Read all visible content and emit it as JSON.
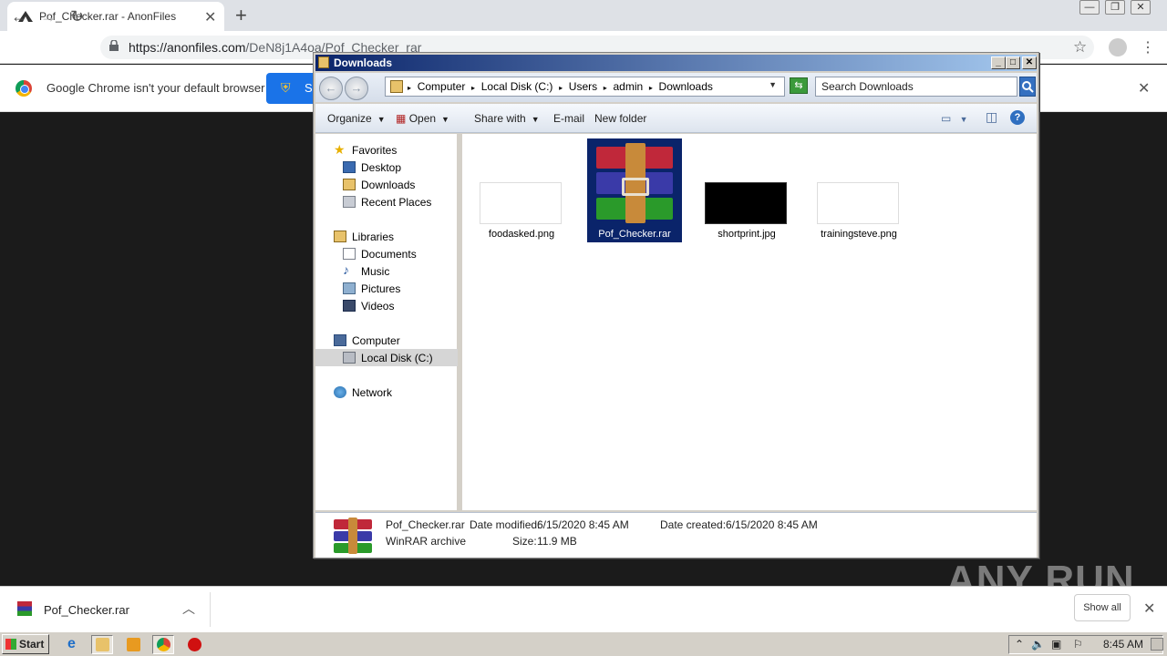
{
  "browser": {
    "tab_title": "Pof_Checker.rar - AnonFiles",
    "url_host": "https://anonfiles.com",
    "url_path": "/DeN8j1A4oa/Pof_Checker_rar",
    "infobar_text": "Google Chrome isn't your default browser",
    "set_default_label": "S"
  },
  "explorer": {
    "title": "Downloads",
    "breadcrumbs": [
      "Computer",
      "Local Disk (C:)",
      "Users",
      "admin",
      "Downloads"
    ],
    "search_placeholder": "Search Downloads",
    "commands": {
      "organize": "Organize",
      "open": "Open",
      "share": "Share with",
      "email": "E-mail",
      "new_folder": "New folder"
    },
    "nav": {
      "favorites": "Favorites",
      "desktop": "Desktop",
      "downloads": "Downloads",
      "recent": "Recent Places",
      "libraries": "Libraries",
      "documents": "Documents",
      "music": "Music",
      "pictures": "Pictures",
      "videos": "Videos",
      "computer": "Computer",
      "local_disk": "Local Disk (C:)",
      "network": "Network"
    },
    "files": [
      {
        "name": "foodasked.png",
        "thumb": "#ffffff"
      },
      {
        "name": "Pof_Checker.rar",
        "thumb": "rar"
      },
      {
        "name": "shortprint.jpg",
        "thumb": "#000000"
      },
      {
        "name": "trainingsteve.png",
        "thumb": "#ffffff"
      }
    ],
    "details": {
      "name": "Pof_Checker.rar",
      "type": "WinRAR archive",
      "modified_label": "Date modified:",
      "modified": "6/15/2020 8:45 AM",
      "size_label": "Size:",
      "size": "11.9 MB",
      "created_label": "Date created:",
      "created": "6/15/2020 8:45 AM"
    }
  },
  "download_shelf": {
    "file": "Pof_Checker.rar",
    "show_all": "Show all"
  },
  "watermark": "ANY RUN",
  "taskbar": {
    "start": "Start",
    "clock": "8:45 AM"
  }
}
